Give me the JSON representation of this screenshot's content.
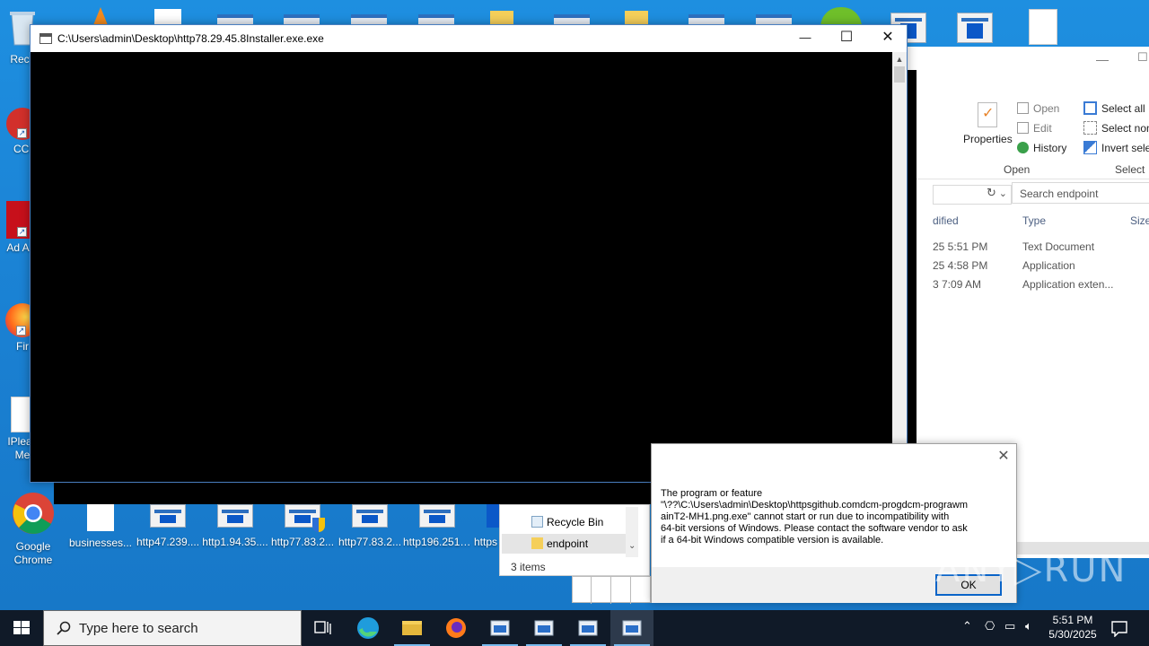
{
  "desktop": {
    "left_icons": [
      {
        "label": "Recy"
      },
      {
        "label": "CCl"
      },
      {
        "label": "Ad Acr"
      },
      {
        "label": "Fir"
      },
      {
        "label": "IPleas Me"
      },
      {
        "label": "Google Chrome"
      }
    ],
    "bottom_icons": [
      {
        "label": "businesses..."
      },
      {
        "label": "http47.239...."
      },
      {
        "label": "http1.94.35...."
      },
      {
        "label": "http77.83.2..."
      },
      {
        "label": "http77.83.2..."
      },
      {
        "label": "http196.251...."
      },
      {
        "label": "https"
      }
    ]
  },
  "console_window": {
    "title": "C:\\Users\\admin\\Desktop\\http78.29.45.8Installer.exe.exe",
    "minimize": "—",
    "maximize": "☐",
    "close": "✕"
  },
  "explorer": {
    "ribbon": {
      "properties": "Properties",
      "open": "Open",
      "edit": "Edit",
      "history": "History",
      "select_all": "Select all",
      "select_none": "Select non",
      "invert_selection": "Invert selec",
      "group_open": "Open",
      "group_select": "Select"
    },
    "search_placeholder": "Search endpoint",
    "columns": {
      "modified": "dified",
      "type": "Type",
      "size": "Size"
    },
    "rows": [
      {
        "modified": "25 5:51 PM",
        "type": "Text Document"
      },
      {
        "modified": "25 4:58 PM",
        "type": "Application"
      },
      {
        "modified": "3 7:09 AM",
        "type": "Application exten..."
      }
    ]
  },
  "navpane": {
    "items": [
      {
        "label": "Recycle Bin"
      },
      {
        "label": "endpoint"
      }
    ],
    "status": "3 items"
  },
  "dialog": {
    "message": "The program or feature\n\"\\??\\C:\\Users\\admin\\Desktop\\httpsgithub.comdcm-progdcm-prograwm\nainT2-MH1.png.exe\" cannot start or run due to incompatibility with\n64-bit versions of Windows. Please contact the software vendor to ask\nif a 64-bit Windows compatible version is available.",
    "ok": "OK"
  },
  "watermark": "ANY▷RUN",
  "taskbar": {
    "search_placeholder": "Type here to search",
    "time": "5:51 PM",
    "date": "5/30/2025"
  }
}
